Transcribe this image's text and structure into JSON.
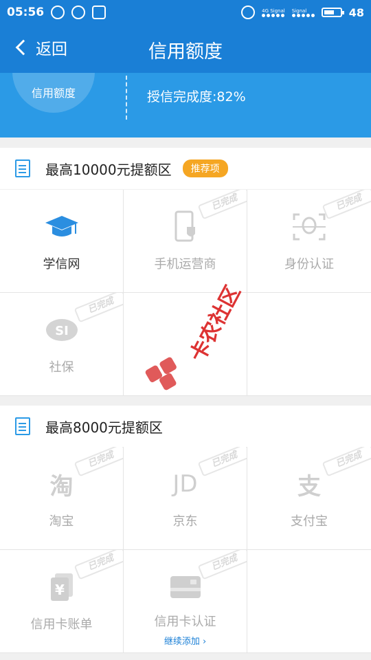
{
  "status_bar": {
    "time": "05:56",
    "network_label_1": "4G Signal",
    "network_label_2": "Signal",
    "battery": "48"
  },
  "nav": {
    "back_label": "返回",
    "title": "信用额度"
  },
  "hero": {
    "circle_label": "信用额度",
    "progress_text": "授信完成度:82%"
  },
  "sections": [
    {
      "title": "最高10000元提额区",
      "badge": "推荐项",
      "items": [
        {
          "label": "学信网",
          "icon": "graduation-cap-icon",
          "stamp": ""
        },
        {
          "label": "手机运营商",
          "icon": "phone-shield-icon",
          "stamp": "已完成"
        },
        {
          "label": "身份认证",
          "icon": "face-scan-icon",
          "stamp": "已完成"
        },
        {
          "label": "社保",
          "icon": "social-security-icon",
          "stamp": "已完成"
        }
      ]
    },
    {
      "title": "最高8000元提额区",
      "items": [
        {
          "label": "淘宝",
          "icon_text": "淘",
          "stamp": "已完成"
        },
        {
          "label": "京东",
          "icon_text": "JD",
          "stamp": "已完成"
        },
        {
          "label": "支付宝",
          "icon_text": "支",
          "stamp": "已完成"
        },
        {
          "label": "信用卡账单",
          "icon_text": "¥",
          "stamp": "已完成"
        },
        {
          "label": "信用卡认证",
          "sub": "继续添加 ›",
          "icon": "credit-card-icon",
          "stamp": "已完成"
        }
      ]
    }
  ],
  "watermark": {
    "text": "卡农社区"
  },
  "colors": {
    "primary": "#1a7fd6",
    "hero": "#2b9ae6",
    "badge": "#f5a623",
    "disabled": "#aaaaaa"
  }
}
